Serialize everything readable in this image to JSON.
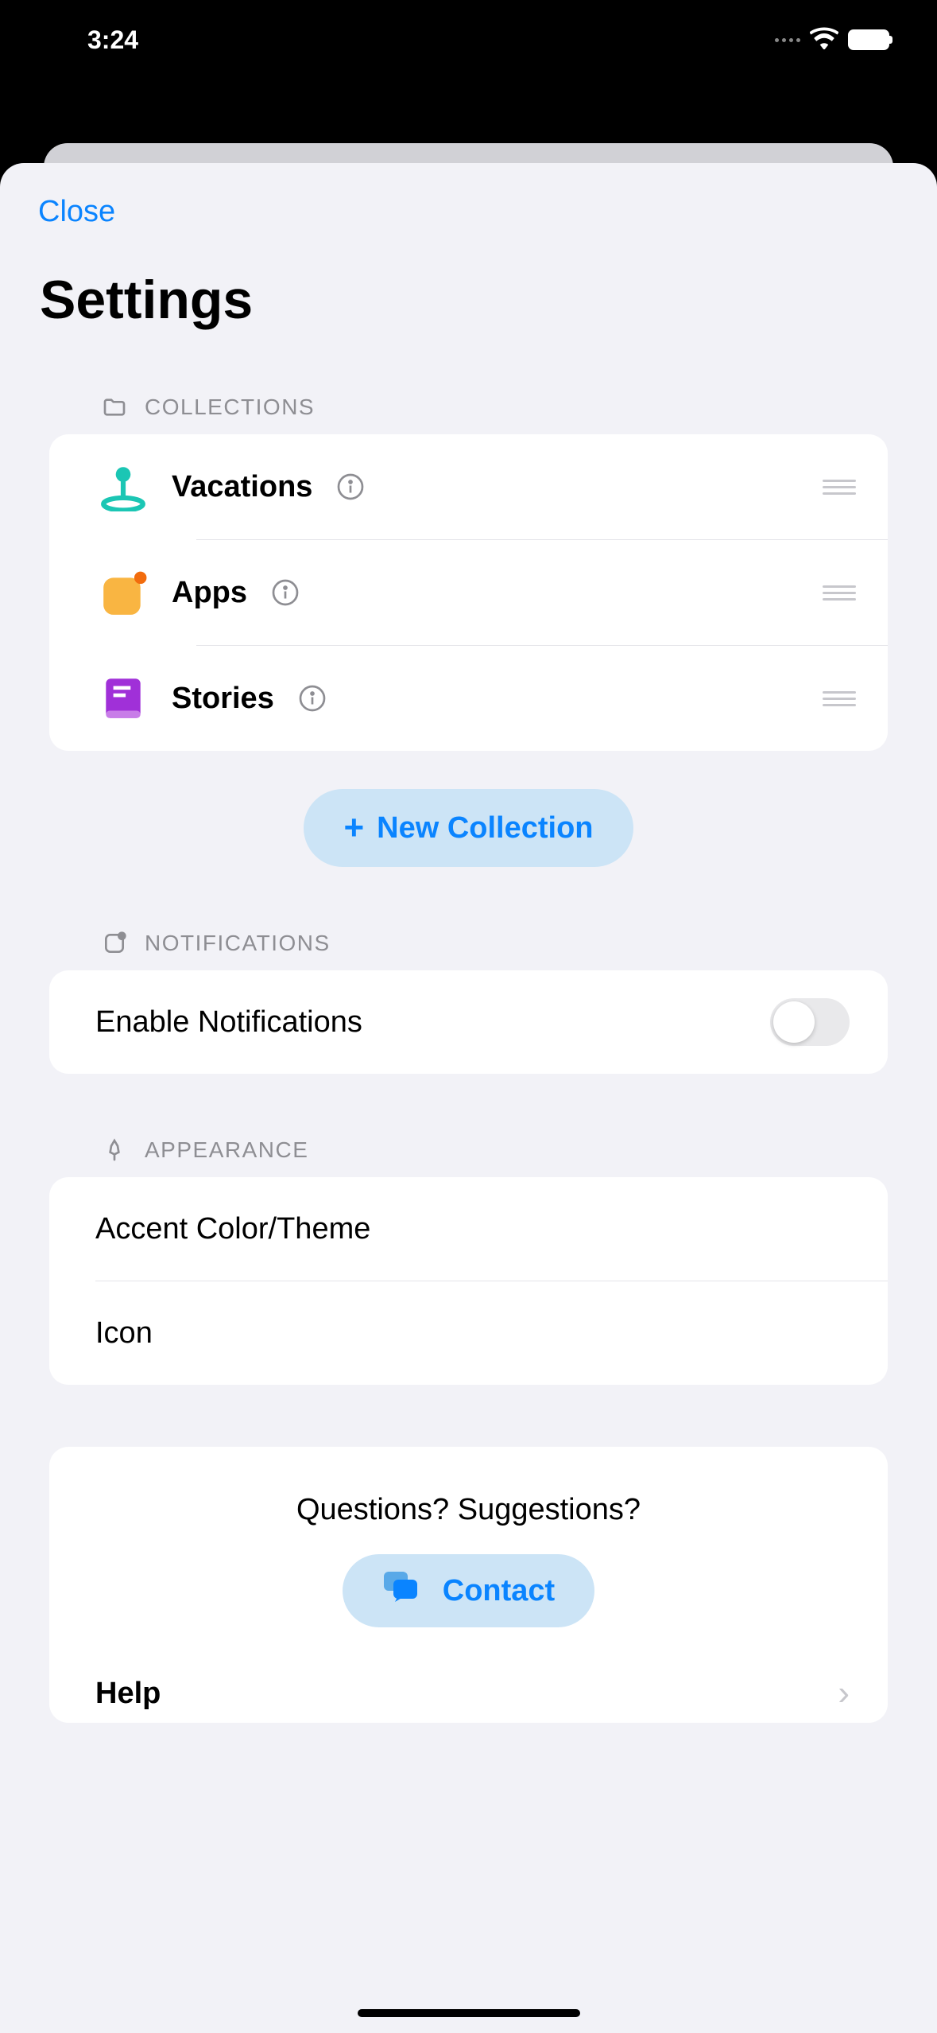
{
  "statusBar": {
    "time": "3:24"
  },
  "header": {
    "closeLabel": "Close",
    "title": "Settings"
  },
  "collections": {
    "header": "COLLECTIONS",
    "items": [
      {
        "label": "Vacations"
      },
      {
        "label": "Apps"
      },
      {
        "label": "Stories"
      }
    ],
    "newButton": "New Collection"
  },
  "notifications": {
    "header": "NOTIFICATIONS",
    "enableLabel": "Enable Notifications",
    "enabled": false
  },
  "appearance": {
    "header": "APPEARANCE",
    "items": [
      {
        "label": "Accent Color/Theme"
      },
      {
        "label": "Icon"
      }
    ]
  },
  "feedback": {
    "prompt": "Questions? Suggestions?",
    "contactLabel": "Contact",
    "helpLabel": "Help"
  }
}
